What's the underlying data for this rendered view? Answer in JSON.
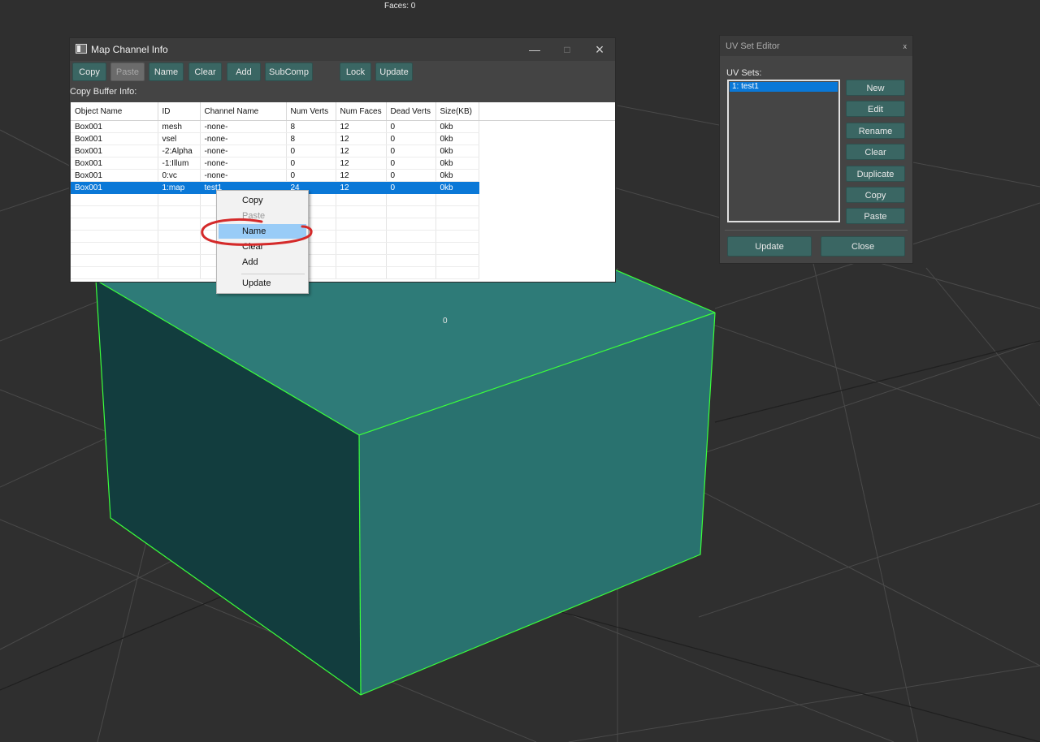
{
  "viewport": {
    "faces_label": "Faces: 0",
    "vertex_label": "0",
    "object_color": "#29726f",
    "edge_color": "#3bff3b"
  },
  "map_channel_info": {
    "title": "Map Channel Info",
    "toolbar": {
      "copy": "Copy",
      "paste": "Paste",
      "name": "Name",
      "clear": "Clear",
      "add": "Add",
      "subcomp": "SubComp",
      "lock": "Lock",
      "update": "Update"
    },
    "copy_buffer_label": "Copy Buffer Info:",
    "columns": [
      "Object Name",
      "ID",
      "Channel Name",
      "Num Verts",
      "Num Faces",
      "Dead Verts",
      "Size(KB)"
    ],
    "rows": [
      [
        "Box001",
        "mesh",
        "-none-",
        "8",
        "12",
        "0",
        "0kb"
      ],
      [
        "Box001",
        "vsel",
        "-none-",
        "8",
        "12",
        "0",
        "0kb"
      ],
      [
        "Box001",
        "-2:Alpha",
        "-none-",
        "0",
        "12",
        "0",
        "0kb"
      ],
      [
        "Box001",
        "-1:Illum",
        "-none-",
        "0",
        "12",
        "0",
        "0kb"
      ],
      [
        "Box001",
        "0:vc",
        "-none-",
        "0",
        "12",
        "0",
        "0kb"
      ],
      [
        "Box001",
        "1:map",
        "test1",
        "24",
        "12",
        "0",
        "0kb"
      ]
    ],
    "selected_row": 5
  },
  "context_menu": {
    "items": [
      {
        "label": "Copy",
        "enabled": true
      },
      {
        "label": "Paste",
        "enabled": false
      },
      {
        "label": "Name",
        "enabled": true,
        "highlighted": true
      },
      {
        "label": "Clear",
        "enabled": true
      },
      {
        "label": "Add",
        "enabled": true
      },
      {
        "label": "Update",
        "enabled": true
      }
    ],
    "annotation_color": "#d42a2a"
  },
  "uv_set_editor": {
    "title": "UV Set Editor",
    "close_glyph": "x",
    "uv_sets_label": "UV Sets:",
    "uv_sets": [
      "1: test1"
    ],
    "buttons": {
      "new": "New",
      "edit": "Edit",
      "rename": "Rename",
      "clear": "Clear",
      "duplicate": "Duplicate",
      "copy": "Copy",
      "paste": "Paste"
    },
    "update": "Update",
    "close": "Close"
  }
}
